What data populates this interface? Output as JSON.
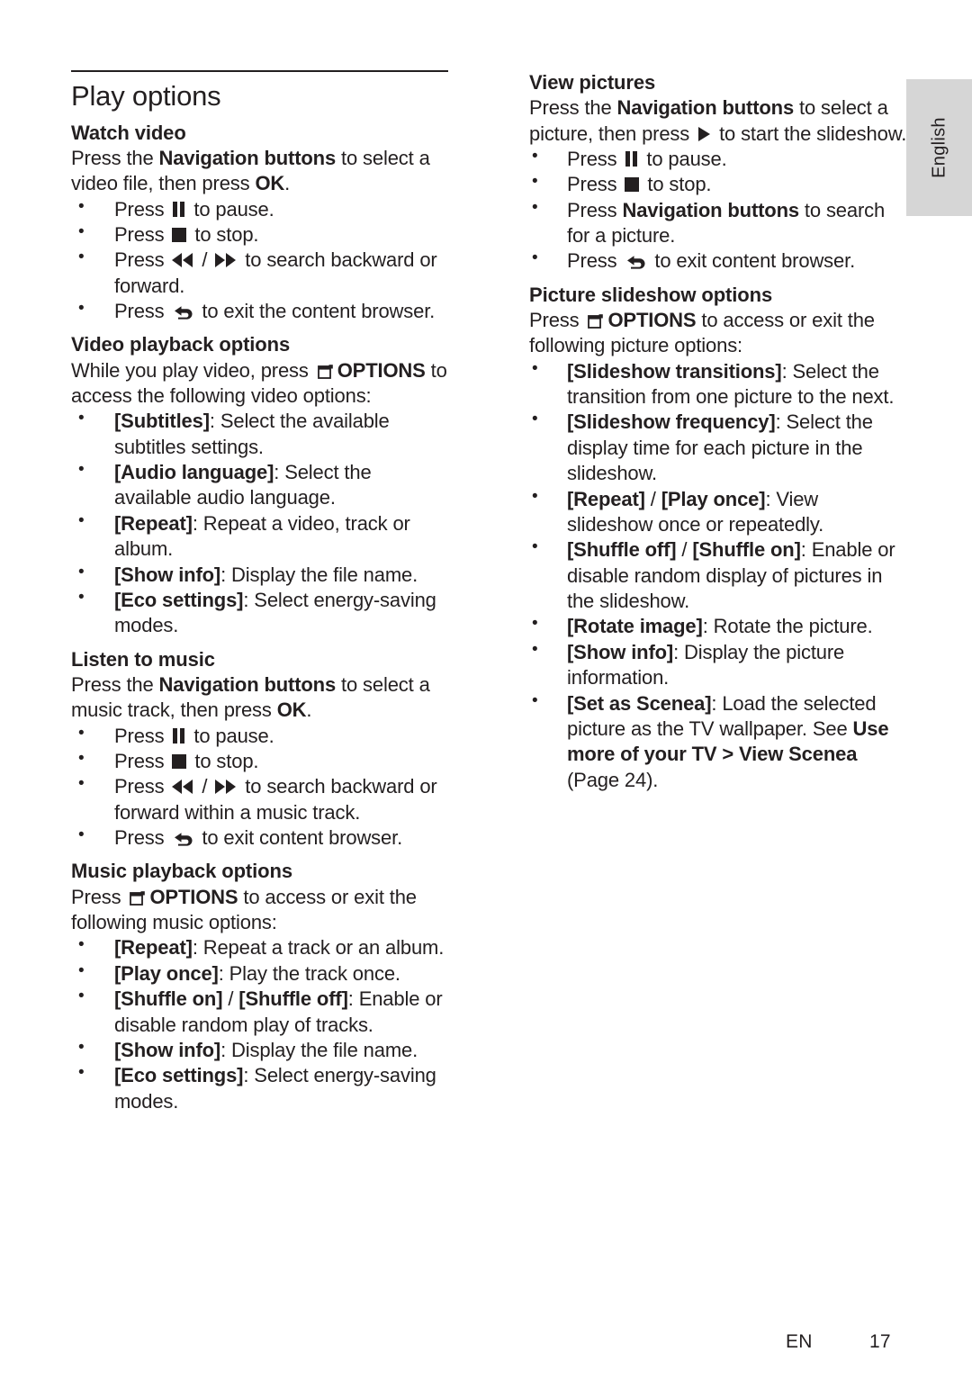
{
  "language_tab": {
    "label": "English"
  },
  "footer": {
    "locale_code": "EN",
    "page_number": "17"
  },
  "page": {
    "title": "Play options"
  },
  "left_column": {
    "watch_video": {
      "heading": "Watch video",
      "intro_1": "Press the ",
      "intro_bold": "Navigation buttons",
      "intro_2": " to select a video file, then press ",
      "intro_bold2": "OK",
      "intro_3": ".",
      "bullets": [
        {
          "pre": "Press ",
          "icon": "pause-icon",
          "post": " to pause."
        },
        {
          "pre": "Press ",
          "icon": "stop-icon",
          "post": " to stop."
        },
        {
          "pre": "Press ",
          "icon": "rewind-forward-icon",
          "post": " to search backward or forward."
        },
        {
          "pre": "Press ",
          "icon": "back-icon",
          "post": " to exit the content browser."
        }
      ]
    },
    "video_playback_options": {
      "heading": "Video playback options",
      "intro_1": "While you play video, press ",
      "intro_icon": "options-icon",
      "intro_bold": "OPTIONS",
      "intro_2": " to access the following video options:",
      "bullets": [
        {
          "term": "[Subtitles]",
          "desc": ": Select the available subtitles settings."
        },
        {
          "term": "[Audio language]",
          "desc": ": Select the available audio language."
        },
        {
          "term": "[Repeat]",
          "desc": ": Repeat a video, track or album."
        },
        {
          "term": "[Show info]",
          "desc": ": Display the file name."
        },
        {
          "term": "[Eco settings]",
          "desc": ": Select energy-saving modes."
        }
      ]
    },
    "listen_to_music": {
      "heading": "Listen to music",
      "intro_1": "Press the ",
      "intro_bold": "Navigation buttons",
      "intro_2": " to select a music track, then press ",
      "intro_bold2": "OK",
      "intro_3": ".",
      "bullets": [
        {
          "pre": "Press ",
          "icon": "pause-icon",
          "post": " to pause."
        },
        {
          "pre": "Press ",
          "icon": "stop-icon",
          "post": " to stop."
        },
        {
          "pre": "Press ",
          "icon": "rewind-forward-icon",
          "post": " to search backward or forward within a music track."
        },
        {
          "pre": "Press ",
          "icon": "back-icon",
          "post": " to exit content browser."
        }
      ]
    },
    "music_playback_options": {
      "heading": "Music playback options",
      "intro_1": "Press ",
      "intro_icon": "options-icon",
      "intro_bold": "OPTIONS",
      "intro_2": " to access or exit the following music options:",
      "bullets": [
        {
          "term": "[Repeat]",
          "desc": ": Repeat a track or an album."
        },
        {
          "term": "[Play once]",
          "desc": ": Play the track once."
        },
        {
          "term": "[Shuffle on]",
          "term2": "[Shuffle off]",
          "separator": " / ",
          "desc": ": Enable or disable random play of tracks."
        },
        {
          "term": "[Show info]",
          "desc": ": Display the file name."
        },
        {
          "term": "[Eco settings]",
          "desc": ": Select energy-saving modes."
        }
      ]
    }
  },
  "right_column": {
    "view_pictures": {
      "heading": "View pictures",
      "intro_1": "Press the ",
      "intro_bold": "Navigation buttons",
      "intro_2": " to select a picture, then press ",
      "intro_icon": "play-icon",
      "intro_3": " to start the slideshow.",
      "bullets": [
        {
          "pre": "Press ",
          "icon": "pause-icon",
          "post": " to pause."
        },
        {
          "pre": "Press ",
          "icon": "stop-icon",
          "post": " to stop."
        },
        {
          "pre": "Press ",
          "bold": "Navigation buttons",
          "post": " to search for a picture."
        },
        {
          "pre": "Press ",
          "icon": "back-icon",
          "post": " to exit content browser."
        }
      ]
    },
    "picture_slideshow_options": {
      "heading": "Picture slideshow options",
      "intro_1": "Press ",
      "intro_icon": "options-icon",
      "intro_bold": "OPTIONS",
      "intro_2": " to access or exit the following picture options:",
      "bullets": [
        {
          "term": "[Slideshow transitions]",
          "desc": ": Select the transition from one picture to the next."
        },
        {
          "term": "[Slideshow frequency]",
          "desc": ": Select the display time for each picture in the slideshow."
        },
        {
          "term": "[Repeat]",
          "term2": "[Play once]",
          "separator": " / ",
          "desc": ": View slideshow once or repeatedly."
        },
        {
          "term": "[Shuffle off]",
          "term2": "[Shuffle on]",
          "separator": " / ",
          "desc": ": Enable or disable random display of pictures in the slideshow."
        },
        {
          "term": "[Rotate image]",
          "desc": ": Rotate the picture."
        },
        {
          "term": "[Show info]",
          "desc": ": Display the picture information."
        },
        {
          "term": "[Set as Scenea]",
          "desc": ": Load the selected picture as the TV wallpaper. See ",
          "xref_bold": "Use more of your TV > View Scenea",
          "desc_tail": " (Page 24)."
        }
      ]
    }
  }
}
